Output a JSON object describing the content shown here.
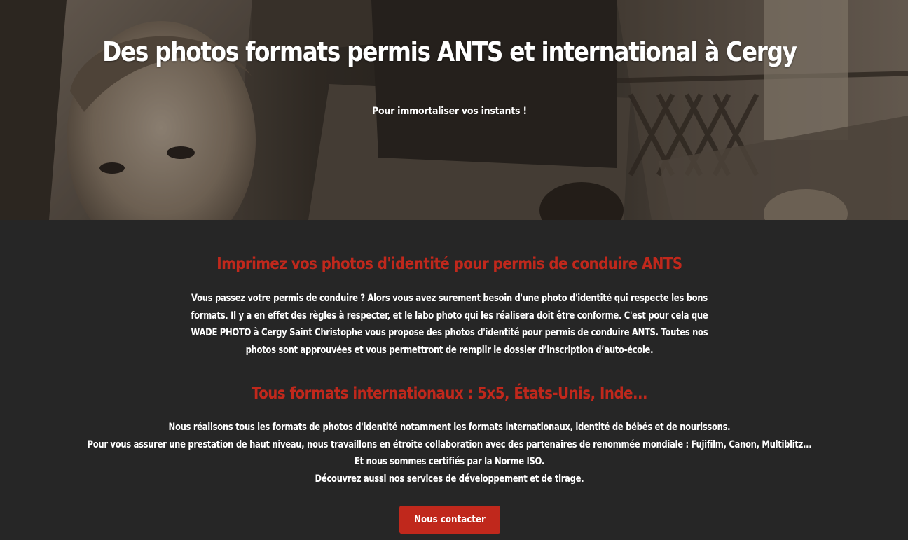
{
  "hero": {
    "title": "Des photos formats permis ANTS et international à Cergy",
    "subtitle": "Pour immortaliser vos instants !"
  },
  "section_ants": {
    "title": "Imprimez vos photos d'identité pour permis de conduire ANTS",
    "lines": [
      "Vous passez votre permis de conduire ? Alors vous avez surement besoin d'une photo d'identité qui respecte les bons",
      "formats. Il y a en effet des règles à respecter, et le labo photo qui les réalisera doit être conforme. C'est pour cela que",
      "WADE PHOTO à Cergy Saint Christophe vous propose des photos d'identité pour permis de conduire ANTS. Toutes nos",
      "photos sont approuvées et vous permettront de remplir le dossier d’inscription d’auto-école."
    ]
  },
  "section_international": {
    "title": "Tous formats internationaux : 5x5, États-Unis, Inde...",
    "lines": [
      "Nous réalisons tous les formats de photos d'identité notamment les formats internationaux, identité de bébés et de nourissons.",
      "Pour vous assurer une prestation de haut niveau, nous travaillons en étroite collaboration avec des partenaires de renommée mondiale : Fujifilm, Canon, Multiblitz...",
      "Et nous sommes certifiés par la Norme ISO.",
      "Découvrez aussi nos services de développement et de tirage."
    ]
  },
  "cta": {
    "label": "Nous contacter"
  },
  "colors": {
    "accent": "#c0281c",
    "background": "#262626",
    "text": "#ffffff"
  }
}
